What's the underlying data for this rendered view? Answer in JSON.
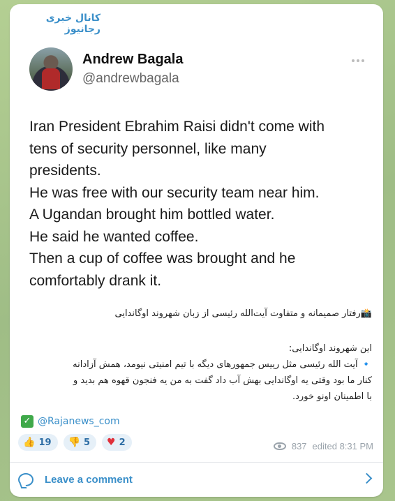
{
  "channel": {
    "name": "کانال خبری رجانیوز"
  },
  "tweet": {
    "display_name": "Andrew Bagala",
    "handle": "@andrewbagala",
    "lines": [
      "Iran President Ebrahim Raisi didn't come with",
      "tens of security personnel, like many",
      "presidents.",
      "He was free with our security team near him.",
      "A Ugandan brought him bottled water.",
      "He said he wanted coffee.",
      "Then a cup of coffee was brought and he",
      "comfortably drank it."
    ]
  },
  "caption": {
    "title": "📸رفتار صمیمانه و متفاوت آیت‌الله رئیسی از زبان شهروند اوگاندایی",
    "body": [
      "این شهروند اوگاندایی:",
      "🔹 آیت الله رئیسی مثل رییس جمهورهای دیگه با تیم امنیتی نیومد، همش آزادانه",
      "کنار ما بود وقتی یه اوگاندایی بهش آب داد گفت به من یه فنجون قهوه هم بدید و",
      "با اطمینان اونو خورد."
    ]
  },
  "source": {
    "check": "✓",
    "label": "@Rajanews_com"
  },
  "reactions": [
    {
      "emoji": "👍",
      "count": "19"
    },
    {
      "emoji": "👎",
      "count": "5"
    },
    {
      "emoji": "♥",
      "count": "2"
    }
  ],
  "meta": {
    "views": "837",
    "edited": "edited 8:31 PM"
  },
  "footer": {
    "comment_label": "Leave a comment"
  }
}
